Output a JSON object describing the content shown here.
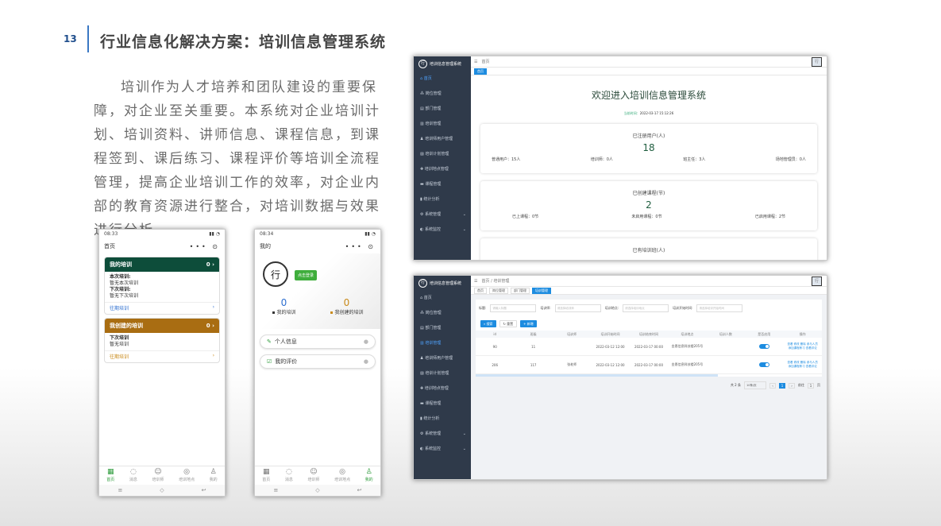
{
  "slide": {
    "page_number": "13",
    "title": "行业信息化解决方案：培训信息管理系统",
    "paragraph": "培训作为人才培养和团队建设的重要保障，对企业至关重要。本系统对企业培训计划、培训资料、讲师信息、课程信息，到课程签到、课后练习、课程评价等培训全流程管理，提高企业培训工作的效率，对企业内部的教育资源进行整合，对培训数据与效果进行分析。"
  },
  "phone1": {
    "status_left": "08:33",
    "header_title": "首页",
    "header_ctl": "•••",
    "card1": {
      "title": "我的培训",
      "count": "0",
      "line1_label": "本次培训:",
      "line1_value": "暂无本次培训",
      "line2_label": "下次培训:",
      "line2_value": "暂无下次培训",
      "footer": "往期培训",
      "color": "#0d4d3a"
    },
    "card2": {
      "title": "我创建的培训",
      "count": "0",
      "line1_label": "下次培训",
      "line1_value": "暂无培训",
      "footer": "往期培训",
      "color": "#a96d12"
    }
  },
  "phone2": {
    "status_left": "08:34",
    "header_title": "我的",
    "login": "点击登录",
    "stat1_num": "0",
    "stat1_label": "我的培训",
    "stat2_num": "0",
    "stat2_label": "我创建的培训",
    "menu1": "个人信息",
    "menu2": "我的评价"
  },
  "tabs": [
    "首页",
    "消息",
    "培训师",
    "培训地点",
    "我的"
  ],
  "admin1": {
    "system_name": "培训信息管理系统",
    "nav_home": "首页",
    "menu": [
      "首页",
      "岗位管理",
      "部门管理",
      "培训管理",
      "培训师用户管理",
      "培训计划管理",
      "培训地点管理",
      "课程管理",
      "统计分析",
      "系统管理",
      "系统监控"
    ],
    "welcome": "欢迎进入培训信息管理系统",
    "time_label": "当前时间：",
    "time": "2022-03-17 15:12:26",
    "card1": {
      "title": "已注册用户(人)",
      "num": "18",
      "items": [
        "普通用户：15人",
        "培训师：0人",
        "班主任：3人",
        "场地管理员：0人"
      ]
    },
    "card2": {
      "title": "已创建课程(节)",
      "num": "2",
      "items": [
        "已上课程：0节",
        "未启用课程：0节",
        "已启用课程：2节"
      ]
    },
    "card3_title": "已有培训班(人)"
  },
  "admin2": {
    "breadcrumb": [
      "首页",
      "培训管理"
    ],
    "tabs": [
      "首页",
      "岗位管理",
      "部门管理",
      "培训管理"
    ],
    "filters": [
      "标题:",
      "培训师:",
      "培训地点:",
      "培训开始时间:"
    ],
    "filter_placeholders": [
      "请输入标题",
      "请选择培训师",
      "请选择培训地点",
      "请选择培训开始时间"
    ],
    "buttons": [
      "搜索",
      "重置",
      "新增"
    ],
    "columns": [
      "id",
      "班级",
      "培训师",
      "培训开始时间",
      "培训结束时间",
      "培训地点",
      "培训人数",
      "是否启用",
      "操作"
    ],
    "rows": [
      {
        "id": "90",
        "class": "11",
        "teacher": "",
        "start": "2022-03-12 12:00",
        "end": "2022-03-17 00:00",
        "place": "金恩信息科技楼205号",
        "count": "",
        "ops": [
          "查看",
          "修改",
          "删除",
          "参与人员",
          "添加课程练习",
          "查看评论"
        ]
      },
      {
        "id": "206",
        "class": "117",
        "teacher": "张老师",
        "start": "2022-03-12 12:00",
        "end": "2022-03-17 00:00",
        "place": "金恩信息科技楼205号",
        "count": "",
        "ops": [
          "查看",
          "修改",
          "删除",
          "参与人员",
          "添加课程练习",
          "查看评论"
        ]
      }
    ],
    "pager": {
      "total": "共 2 条",
      "size": "10条/页",
      "page": "1",
      "goto": "前往",
      "goto_page": "1",
      "unit": "页"
    }
  }
}
